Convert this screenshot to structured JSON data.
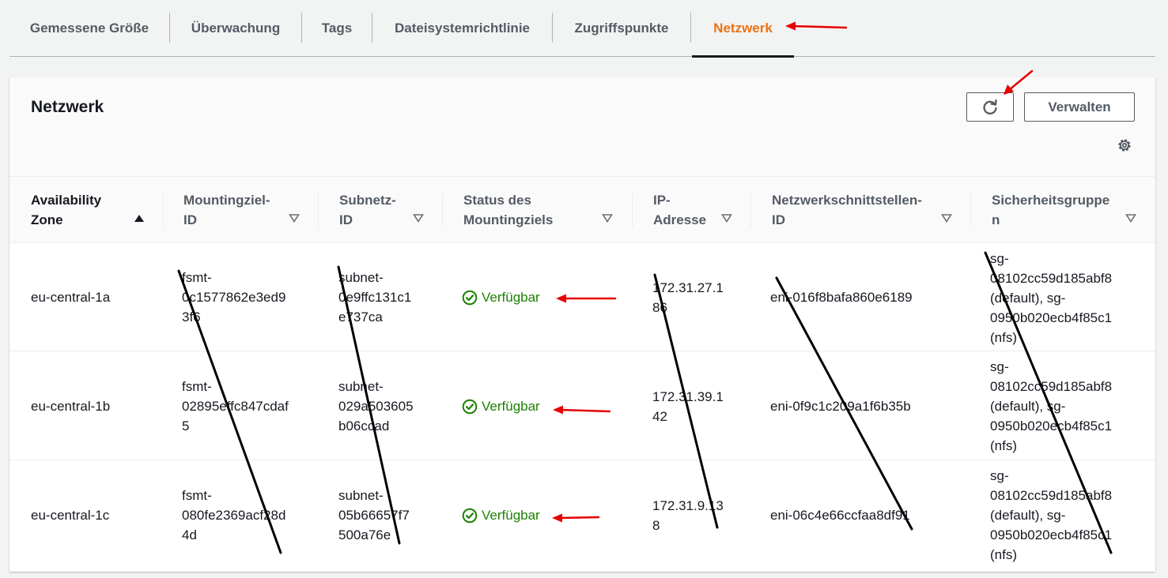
{
  "tabs": [
    {
      "label": "Gemessene Größe"
    },
    {
      "label": "Überwachung"
    },
    {
      "label": "Tags"
    },
    {
      "label": "Dateisystemrichtlinie"
    },
    {
      "label": "Zugriffspunkte"
    },
    {
      "label": "Netzwerk",
      "active": true
    }
  ],
  "panel": {
    "title": "Netzwerk",
    "refresh_icon": "refresh-icon",
    "manage_label": "Verwalten",
    "settings_icon": "gear-icon"
  },
  "table": {
    "columns": [
      {
        "label": "Availability\nZone",
        "sort": "ascending"
      },
      {
        "label": "Mountingziel-\nID",
        "sort": "none"
      },
      {
        "label": "Subnetz-\nID",
        "sort": "none"
      },
      {
        "label": "Status des\nMountingziels",
        "sort": "none"
      },
      {
        "label": "IP-\nAdresse",
        "sort": "none"
      },
      {
        "label": "Netzwerkschnittstellen-\nID",
        "sort": "none"
      },
      {
        "label": "Sicherheitsgruppe\nn",
        "sort": "none"
      }
    ],
    "rows": [
      {
        "az": "eu-central-1a",
        "mount_id": "fsmt-\n0c1577862e3ed9\n3f6",
        "subnet_id": "subnet-\n0e9ffc131c1\ne737ca",
        "status": "Verfügbar",
        "ip": "172.31.27.1\n86",
        "eni": "eni-016f8bafa860e6189",
        "sg": "sg-\n08102cc59d185abf8\n(default), sg-\n0950b020ecb4f85c1\n(nfs)"
      },
      {
        "az": "eu-central-1b",
        "mount_id": "fsmt-\n02895effc847cdaf\n5",
        "subnet_id": "subnet-\n029a503605\nb06ccad",
        "status": "Verfügbar",
        "ip": "172.31.39.1\n42",
        "eni": "eni-0f9c1c209a1f6b35b",
        "sg": "sg-\n08102cc59d185abf8\n(default), sg-\n0950b020ecb4f85c1\n(nfs)"
      },
      {
        "az": "eu-central-1c",
        "mount_id": "fsmt-\n080fe2369acf28d\n4d",
        "subnet_id": "subnet-\n05b66657f7\n500a76e",
        "status": "Verfügbar",
        "ip": "172.31.9.13\n8",
        "eni": "eni-06c4e66ccfaa8df91",
        "sg": "sg-\n08102cc59d185abf8\n(default), sg-\n0950b020ecb4f85c1\n(nfs)"
      }
    ],
    "status_icon": "check-circle-icon",
    "status_color": "#1d8102"
  },
  "colors": {
    "active_tab": "#ec7211",
    "annotation_arrow": "#e60000",
    "redaction_line": "#000000"
  }
}
